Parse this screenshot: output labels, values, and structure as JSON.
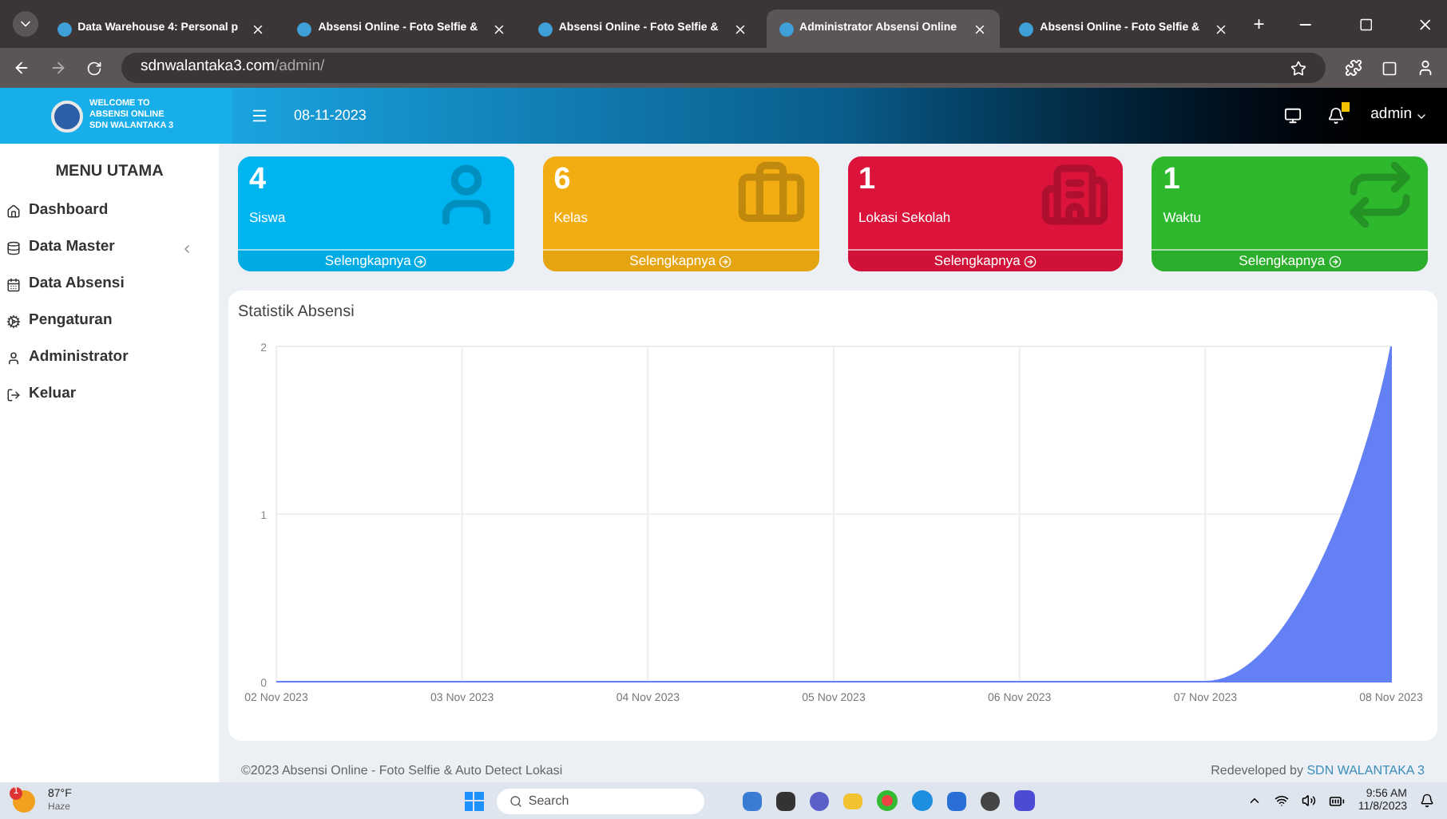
{
  "browser": {
    "tabs": [
      {
        "label": "Data Warehouse 4: Personal p",
        "selected": false
      },
      {
        "label": "Absensi Online - Foto Selfie &",
        "selected": false
      },
      {
        "label": "Absensi Online - Foto Selfie &",
        "selected": false
      },
      {
        "label": "Administrator Absensi Online",
        "selected": true
      },
      {
        "label": "Absensi Online - Foto Selfie &",
        "selected": false
      }
    ],
    "new_tab": "+",
    "url_host": "sdnwalantaka3.com",
    "url_path": "/admin/"
  },
  "header": {
    "logo_lines": [
      "WELCOME TO",
      "ABSENSI ONLINE",
      "SDN WALANTAKA 3"
    ],
    "date": "08-11-2023",
    "user": "admin"
  },
  "sidebar": {
    "title": "MENU UTAMA",
    "items": [
      {
        "label": "Dashboard",
        "submenu": false
      },
      {
        "label": "Data Master",
        "submenu": true
      },
      {
        "label": "Data Absensi",
        "submenu": false
      },
      {
        "label": "Pengaturan",
        "submenu": false
      },
      {
        "label": "Administrator",
        "submenu": false
      },
      {
        "label": "Keluar",
        "submenu": false
      }
    ]
  },
  "cards": [
    {
      "count": "4",
      "label": "Siswa",
      "link": "Selengkapnya",
      "color": "#00b4f0"
    },
    {
      "count": "6",
      "label": "Kelas",
      "link": "Selengkapnya",
      "color": "#f2ad12"
    },
    {
      "count": "1",
      "label": "Lokasi Sekolah",
      "link": "Selengkapnya",
      "color": "#dc143c"
    },
    {
      "count": "1",
      "label": "Waktu",
      "link": "Selengkapnya",
      "color": "#2eb82e"
    }
  ],
  "chart": {
    "title": "Statistik Absensi",
    "chart_data": {
      "type": "area",
      "grid": true,
      "categories": [
        "02 Nov 2023",
        "03 Nov 2023",
        "04 Nov 2023",
        "05 Nov 2023",
        "06 Nov 2023",
        "07 Nov 2023",
        "08 Nov 2023"
      ],
      "series": [
        {
          "color": "#6381f5",
          "values": [
            0,
            0,
            0,
            0,
            0,
            0,
            2
          ]
        }
      ],
      "ylim": [
        0,
        2
      ],
      "yticks": [
        0,
        1,
        2
      ]
    }
  },
  "footer": {
    "left": "©2023 Absensi Online - Foto Selfie & Auto Detect Lokasi",
    "right_prefix": "Redeveloped by",
    "right_link": "SDN WALANTAKA 3"
  },
  "taskbar": {
    "weather_temp": "87°F",
    "weather_desc": "Haze",
    "weather_badge": "1",
    "search_placeholder": "Search",
    "time": "9:56 AM",
    "date": "11/8/2023"
  }
}
